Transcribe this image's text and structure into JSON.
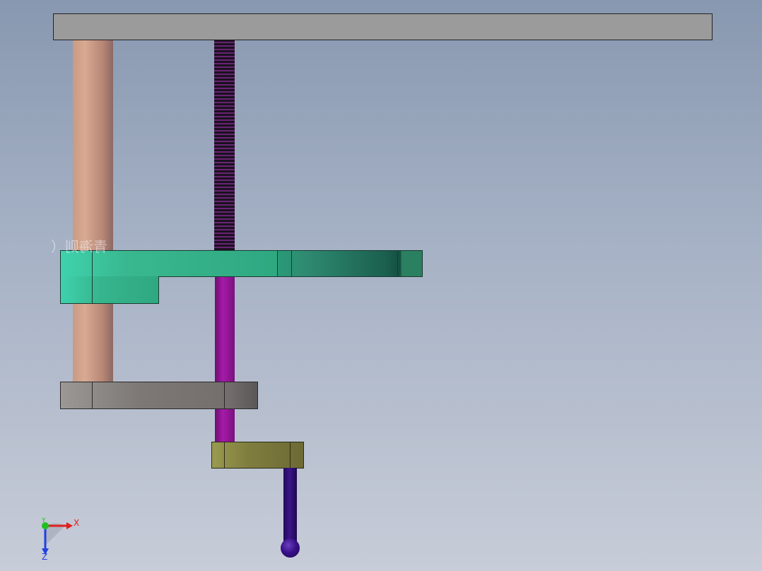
{
  "window": {
    "title": ""
  },
  "model": {
    "parts": [
      {
        "name": "top-plate",
        "color": "#9b9b9b"
      },
      {
        "name": "guide-post",
        "color": "#d8aa92"
      },
      {
        "name": "threaded-rod",
        "color": "#b238c0"
      },
      {
        "name": "upper-arm",
        "color": "#3fd2ad"
      },
      {
        "name": "plunger-rod",
        "color": "#a61aa8"
      },
      {
        "name": "lower-arm",
        "color": "#7d7875"
      },
      {
        "name": "probe-block",
        "color": "#7f7d3e"
      },
      {
        "name": "stylus",
        "color": "#3a168a"
      }
    ],
    "ghost_label": "青海则（"
  },
  "triad": {
    "x_label": "X",
    "y_label": "Y",
    "z_label": "Z",
    "x_color": "#e02020",
    "y_color": "#20c020",
    "z_color": "#2040e0"
  },
  "background": {
    "top": "#8898b0",
    "bottom": "#c7ccd8"
  }
}
